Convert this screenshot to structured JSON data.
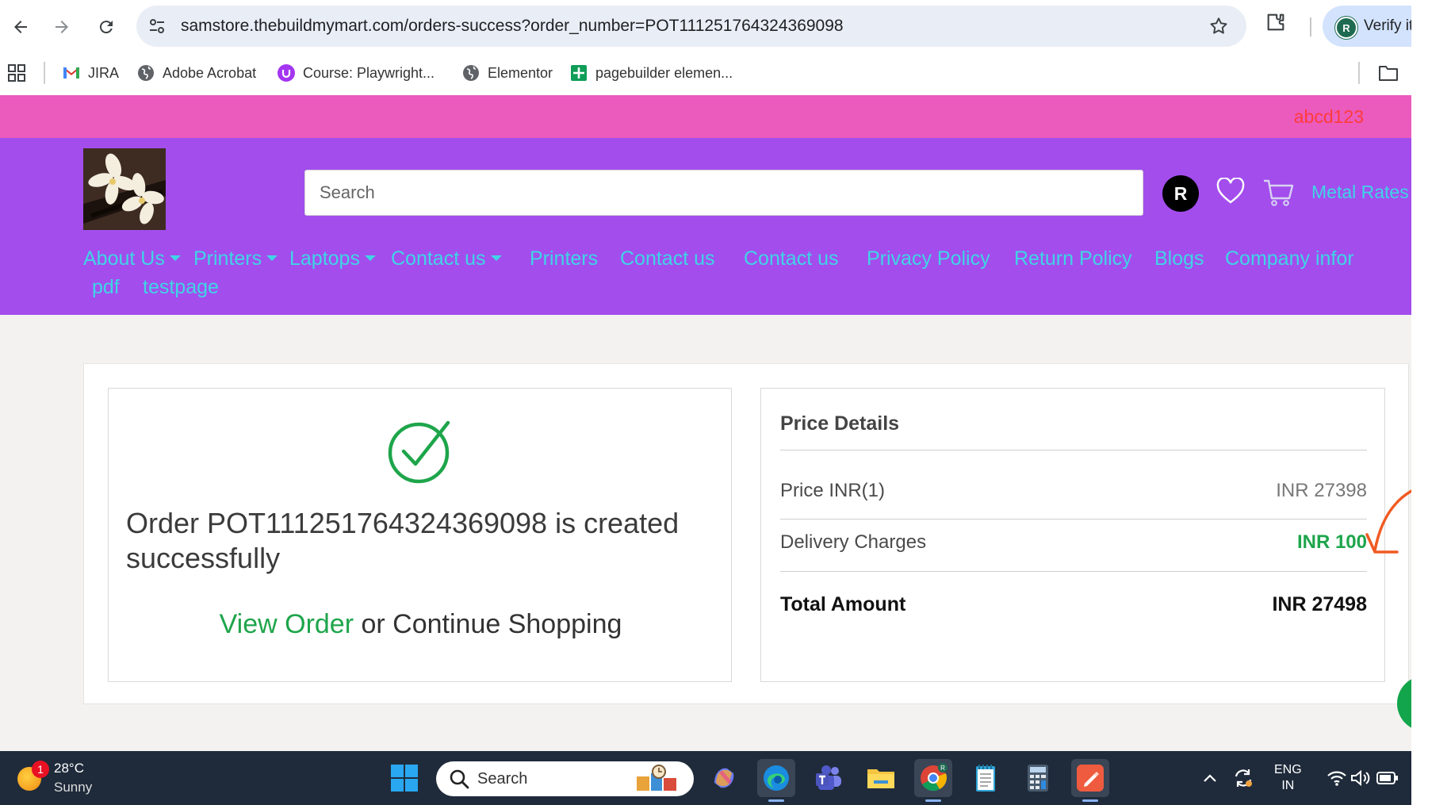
{
  "browser": {
    "url": "samstore.thebuildmymart.com/orders-success?order_number=POT111251764324369098",
    "profile_initial": "R",
    "profile_label": "Verify it"
  },
  "bookmarks": [
    {
      "label": "JIRA",
      "icon": "gmail-icon"
    },
    {
      "label": "Adobe Acrobat",
      "icon": "globe-icon"
    },
    {
      "label": "Course: Playwright...",
      "icon": "udemy-icon"
    },
    {
      "label": "Elementor",
      "icon": "globe-icon"
    },
    {
      "label": "pagebuilder elemen...",
      "icon": "sheets-plus-icon"
    }
  ],
  "site": {
    "user_name": "abcd123",
    "search_placeholder": "Search",
    "avatar_initial": "R",
    "metal_rates": "Metal Rates",
    "menu_row1": [
      {
        "label": "About Us",
        "dropdown": true
      },
      {
        "label": "Printers",
        "dropdown": true
      },
      {
        "label": "Laptops",
        "dropdown": true
      },
      {
        "label": "Contact us",
        "dropdown": true
      },
      {
        "label": "Printers",
        "dropdown": false
      },
      {
        "label": "Contact us",
        "dropdown": false
      },
      {
        "label": "Contact us",
        "dropdown": false
      },
      {
        "label": "Privacy Policy",
        "dropdown": false
      },
      {
        "label": "Return Policy",
        "dropdown": false
      },
      {
        "label": "Blogs",
        "dropdown": false
      },
      {
        "label": "Company infor",
        "dropdown": false
      }
    ],
    "menu_row2": [
      {
        "label": "pdf"
      },
      {
        "label": "testpage"
      }
    ],
    "colors": {
      "pink_bar": "#ea5bbd",
      "header": "#a34ded",
      "menu_text": "#3fd5e5",
      "success_green": "#1ea54b"
    }
  },
  "order": {
    "message": "Order POT111251764324369098 is created successfully",
    "view_order": "View Order",
    "or_text": " or ",
    "continue_shopping": "Continue Shopping"
  },
  "price_details": {
    "title": "Price Details",
    "rows": [
      {
        "label": "Price INR(1)",
        "value": "INR 27398"
      },
      {
        "label": "Delivery Charges",
        "value": "INR 100"
      }
    ],
    "total_label": "Total Amount",
    "total_value": "INR 27498"
  },
  "taskbar": {
    "weather_temp": "28°C",
    "weather_desc": "Sunny",
    "weather_badge": "1",
    "search_label": "Search",
    "lang_line1": "ENG",
    "lang_line2": "IN"
  }
}
